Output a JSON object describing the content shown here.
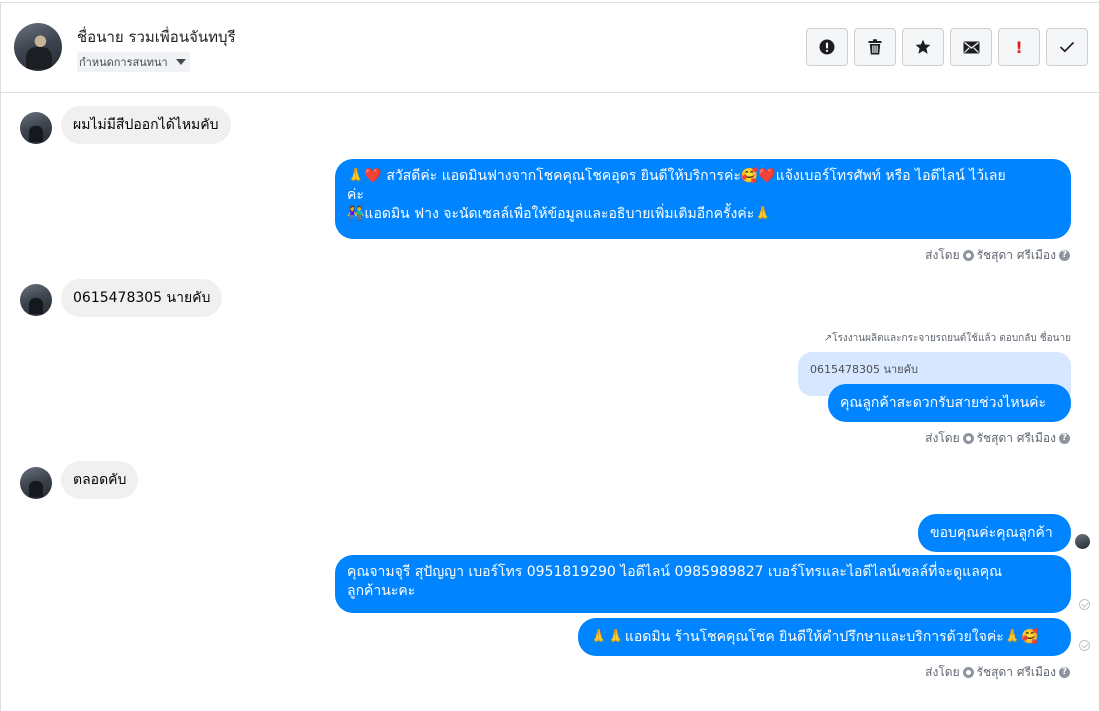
{
  "header": {
    "contact_name": "ชื่อนาย รวมเพื่อนจันทบุรี",
    "label_select": "กำหนดการสนทนา",
    "toolbar": {
      "spam": "!",
      "check": "✓"
    }
  },
  "messages": [
    {
      "direction": "in",
      "text": "ผมไม่มีสีปออกได้ไหมคับ"
    },
    {
      "direction": "out",
      "lines": [
        "🙏❤️ สวัสดีค่ะ แอดมินฟางจากโชคคุณโชคอุดร ยินดีให้บริการค่ะ🥰❤️แจ้งเบอร์โทรศัพท์ หรือ ไอดีไลน์  ไว้เลย",
        "ค่ะ",
        "👫แอดมิน ฟาง จะนัดเซลล์เพื่อให้ข้อมูลและอธิบายเพิ่มเติมอีกครั้งค่ะ🙏"
      ]
    },
    {
      "direction": "in",
      "text": "0615478305 นายคับ"
    },
    {
      "direction": "out",
      "reply_note": "↗โรงงานผลิตและกระจายรถยนต์ใช้แล้ว ตอบกลับ ชื่อนาย",
      "quoted": "0615478305 นายคับ",
      "text": "คุณลูกค้าสะดวกรับสายช่วงไหนค่ะ"
    },
    {
      "direction": "in",
      "text": "ตลอดคับ"
    },
    {
      "direction": "out",
      "text": "ขอบคุณค่ะคุณลูกค้า"
    },
    {
      "direction": "out",
      "lines": [
        "คุณจามจุรี สุปัญญา เบอร์โทร 0951819290  ไอดีไลน์ 0985989827   เบอร์โทรและไอดีไลน์เซลล์ที่จะดูแลคุณ",
        "ลูกค้านะคะ"
      ]
    },
    {
      "direction": "out",
      "text": "🙏🙏แอดมิน ร้านโชคคุณโชค ยินดีให้คำปรึกษาและบริการด้วยใจค่ะ🙏🥰"
    }
  ],
  "sent_by": {
    "prefix": "ส่งโดย",
    "name": "รัชสุดา ศรีเมือง"
  },
  "colors": {
    "outgoing_bubble": "#0084ff",
    "incoming_bubble": "#f0f0f0",
    "quoted_bubble": "#d7e7ff"
  }
}
